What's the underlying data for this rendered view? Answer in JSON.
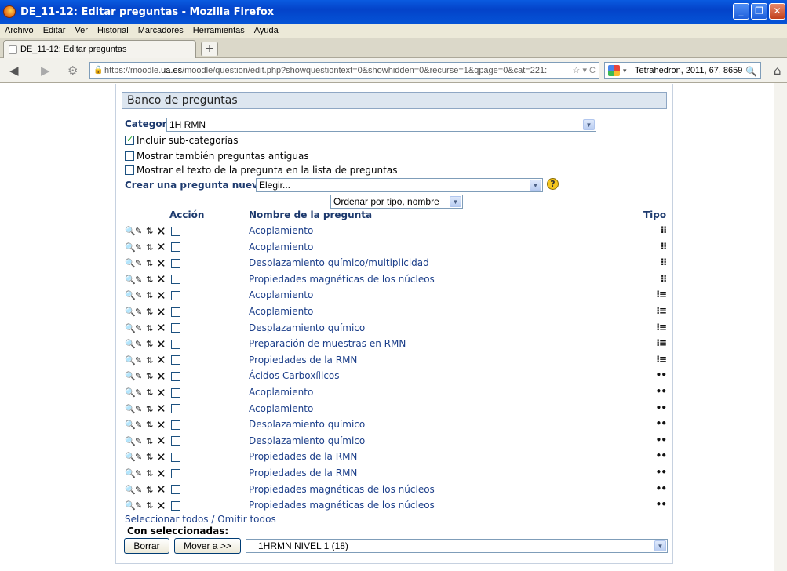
{
  "window": {
    "title": "DE_11-12: Editar preguntas - Mozilla Firefox"
  },
  "menu": [
    "Archivo",
    "Editar",
    "Ver",
    "Historial",
    "Marcadores",
    "Herramientas",
    "Ayuda"
  ],
  "tab": {
    "label": "DE_11-12: Editar preguntas",
    "new_tab": "+"
  },
  "url": {
    "prefix": "https://moodle.",
    "host": "ua.es",
    "path": "/moodle/question/edit.php?showquestiontext=0&showhidden=0&recurse=1&qpage=0&cat=221:"
  },
  "search": {
    "value": "Tetrahedron, 2011, 67, 8659"
  },
  "bank": {
    "title": "Banco de preguntas",
    "category_label": "Categoría",
    "category_value": "1H RMN",
    "include_sub": "Incluir sub-categorías",
    "include_sub_checked": true,
    "show_old": "Mostrar también preguntas antiguas",
    "show_text": "Mostrar el texto de la pregunta en la lista de preguntas",
    "create_label": "Crear una pregunta nueva",
    "create_value": "Elegir...",
    "sort_value": "Ordenar por tipo, nombre",
    "help": "?"
  },
  "table": {
    "col_action": "Acción",
    "col_name": "Nombre de la pregunta",
    "col_type": "Tipo",
    "rows": [
      {
        "name": "Acoplamiento",
        "type": "matching"
      },
      {
        "name": "Acoplamiento",
        "type": "matching"
      },
      {
        "name": "Desplazamiento químico/multiplicidad",
        "type": "matching"
      },
      {
        "name": "Propiedades magnéticas de los núcleos",
        "type": "matching"
      },
      {
        "name": "Acoplamiento",
        "type": "multichoice"
      },
      {
        "name": "Acoplamiento",
        "type": "multichoice"
      },
      {
        "name": "Desplazamiento químico",
        "type": "multichoice"
      },
      {
        "name": "Preparación de muestras en RMN",
        "type": "multichoice"
      },
      {
        "name": "Propiedades de la RMN",
        "type": "multichoice"
      },
      {
        "name": "Ácidos Carboxílicos",
        "type": "truefalse"
      },
      {
        "name": "Acoplamiento",
        "type": "truefalse"
      },
      {
        "name": "Acoplamiento",
        "type": "truefalse"
      },
      {
        "name": "Desplazamiento químico",
        "type": "truefalse"
      },
      {
        "name": "Desplazamiento químico",
        "type": "truefalse"
      },
      {
        "name": "Propiedades de la RMN",
        "type": "truefalse"
      },
      {
        "name": "Propiedades de la RMN",
        "type": "truefalse"
      },
      {
        "name": "Propiedades magnéticas de los núcleos",
        "type": "truefalse"
      },
      {
        "name": "Propiedades magnéticas de los núcleos",
        "type": "truefalse"
      }
    ]
  },
  "footer": {
    "select_all": "Seleccionar todos / Omitir todos",
    "with_selected": "Con seleccionadas:",
    "delete_btn": "Borrar",
    "move_btn": "Mover a >>",
    "move_target": "1HRMN NIVEL 1 (18)"
  },
  "icons": {
    "type_glyphs": {
      "matching": "⁝⁝",
      "multichoice": "⁝≡",
      "truefalse": "••"
    }
  }
}
